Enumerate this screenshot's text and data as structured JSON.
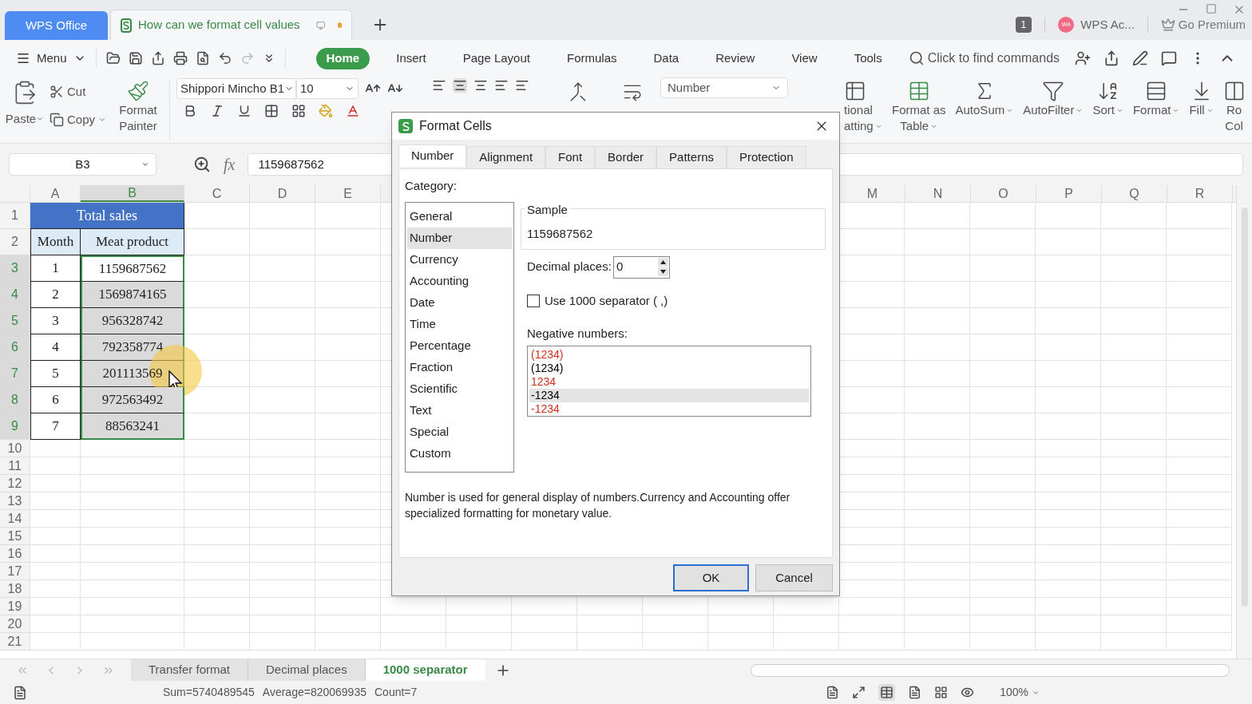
{
  "title_bar": {
    "tabs": [
      {
        "label": "WPS Office",
        "kind": "home",
        "selected": false
      },
      {
        "label": "How  can we format cell values",
        "kind": "document",
        "selected": true
      }
    ],
    "page_count": "1",
    "account_avatar": "WA",
    "account_name": "WPS Ac...",
    "premium": "Go Premium"
  },
  "menu_bar": {
    "menu": "Menu",
    "tabs": [
      {
        "label": "Home",
        "selected": true
      },
      {
        "label": "Insert",
        "selected": false
      },
      {
        "label": "Page Layout",
        "selected": false
      },
      {
        "label": "Formulas",
        "selected": false
      },
      {
        "label": "Data",
        "selected": false
      },
      {
        "label": "Review",
        "selected": false
      },
      {
        "label": "View",
        "selected": false
      },
      {
        "label": "Tools",
        "selected": false
      }
    ],
    "search": {
      "placeholder": "Click to find commands"
    }
  },
  "ribbon": {
    "paste": "Paste",
    "cut": "Cut",
    "copy": "Copy",
    "format_painter": [
      "Format",
      "Painter"
    ],
    "font": "Shippori Mincho B1",
    "font_size": "10",
    "number_format": "Number",
    "right_items": [
      {
        "kind": "cond",
        "lines": [
          "tional",
          "atting"
        ]
      },
      {
        "kind": "table",
        "lines": [
          "Format as",
          "Table"
        ]
      },
      {
        "kind": "sum",
        "lines": [
          "AutoSum"
        ]
      },
      {
        "kind": "filter",
        "lines": [
          "AutoFilter"
        ]
      },
      {
        "kind": "sort",
        "lines": [
          "Sort"
        ]
      },
      {
        "kind": "format",
        "lines": [
          "Format"
        ]
      },
      {
        "kind": "fill",
        "lines": [
          "Fill"
        ]
      },
      {
        "kind": "rows",
        "lines": [
          "Ro",
          "Col"
        ]
      }
    ]
  },
  "formula_bar": {
    "cell": "B3",
    "function_label": "fx",
    "value": "1159687562"
  },
  "sheet": {
    "columns_left": [
      {
        "label": "A",
        "selected": false
      },
      {
        "label": "B",
        "selected": true
      },
      {
        "label": "C",
        "selected": false
      },
      {
        "label": "D",
        "selected": false
      },
      {
        "label": "E",
        "selected": false
      }
    ],
    "columns_right": [
      {
        "label": "M",
        "selected": false
      },
      {
        "label": "N",
        "selected": false
      },
      {
        "label": "O",
        "selected": false
      },
      {
        "label": "P",
        "selected": false
      },
      {
        "label": "Q",
        "selected": false
      },
      {
        "label": "R",
        "selected": false
      }
    ],
    "rows": [
      {
        "number": "1",
        "selected": false,
        "kind": "title",
        "title": "Total sales"
      },
      {
        "number": "2",
        "selected": false,
        "kind": "header",
        "cells": [
          "Month",
          "Meat product"
        ]
      },
      {
        "number": "3",
        "selected": true,
        "kind": "data",
        "month": "1",
        "value": {
          "text": "1159687562",
          "selected": true,
          "active": true
        }
      },
      {
        "number": "4",
        "selected": true,
        "kind": "data",
        "month": "2",
        "value": {
          "text": "1569874165",
          "selected": true,
          "active": false
        }
      },
      {
        "number": "5",
        "selected": true,
        "kind": "data",
        "month": "3",
        "value": {
          "text": "956328742",
          "selected": true,
          "active": false
        }
      },
      {
        "number": "6",
        "selected": true,
        "kind": "data",
        "month": "4",
        "value": {
          "text": "792358774",
          "selected": true,
          "active": false
        }
      },
      {
        "number": "7",
        "selected": true,
        "kind": "data",
        "month": "5",
        "value": {
          "text": "201113569",
          "selected": true,
          "active": false,
          "pointer": true
        }
      },
      {
        "number": "8",
        "selected": true,
        "kind": "data",
        "month": "6",
        "value": {
          "text": "972563492",
          "selected": true,
          "active": false
        }
      },
      {
        "number": "9",
        "selected": true,
        "kind": "data",
        "month": "7",
        "value": {
          "text": "88563241",
          "selected": true,
          "active": false
        }
      },
      {
        "number": "10",
        "selected": false,
        "kind": "empty"
      },
      {
        "number": "11",
        "selected": false,
        "kind": "empty"
      },
      {
        "number": "12",
        "selected": false,
        "kind": "empty"
      },
      {
        "number": "13",
        "selected": false,
        "kind": "empty"
      },
      {
        "number": "14",
        "selected": false,
        "kind": "empty"
      },
      {
        "number": "15",
        "selected": false,
        "kind": "empty"
      },
      {
        "number": "16",
        "selected": false,
        "kind": "empty"
      },
      {
        "number": "17",
        "selected": false,
        "kind": "empty"
      },
      {
        "number": "18",
        "selected": false,
        "kind": "empty"
      },
      {
        "number": "19",
        "selected": false,
        "kind": "empty"
      },
      {
        "number": "20",
        "selected": false,
        "kind": "empty"
      },
      {
        "number": "21",
        "selected": false,
        "kind": "empty"
      }
    ]
  },
  "sheet_tabs": [
    {
      "label": "Transfer format",
      "selected": false
    },
    {
      "label": "Decimal places",
      "selected": false
    },
    {
      "label": "1000 separator",
      "selected": true
    }
  ],
  "status_bar": {
    "stats": [
      "Sum=5740489545",
      "Average=820069935",
      "Count=7"
    ],
    "zoom": "100%"
  },
  "dialog": {
    "title": "Format Cells",
    "tabs": [
      {
        "label": "Number",
        "selected": true
      },
      {
        "label": "Alignment",
        "selected": false
      },
      {
        "label": "Font",
        "selected": false
      },
      {
        "label": "Border",
        "selected": false
      },
      {
        "label": "Patterns",
        "selected": false
      },
      {
        "label": "Protection",
        "selected": false
      }
    ],
    "category_label": "Category:",
    "categories": [
      {
        "label": "General",
        "selected": false
      },
      {
        "label": "Number",
        "selected": true
      },
      {
        "label": "Currency",
        "selected": false
      },
      {
        "label": "Accounting",
        "selected": false
      },
      {
        "label": "Date",
        "selected": false
      },
      {
        "label": "Time",
        "selected": false
      },
      {
        "label": "Percentage",
        "selected": false
      },
      {
        "label": "Fraction",
        "selected": false
      },
      {
        "label": "Scientific",
        "selected": false
      },
      {
        "label": "Text",
        "selected": false
      },
      {
        "label": "Special",
        "selected": false
      },
      {
        "label": "Custom",
        "selected": false
      }
    ],
    "sample_label": "Sample",
    "sample": "1159687562",
    "decimal_label": "Decimal places:",
    "decimal_value": "0",
    "separator": {
      "label": "Use 1000 separator ( ,)",
      "checked": false
    },
    "negative_label": "Negative numbers:",
    "negative_options": [
      {
        "label": "(1234)",
        "color": "#d0301c",
        "selected": false
      },
      {
        "label": "(1234)",
        "color": "#000000",
        "selected": false
      },
      {
        "label": "1234",
        "color": "#d0301c",
        "selected": false
      },
      {
        "label": "-1234",
        "color": "#000000",
        "selected": true
      },
      {
        "label": "-1234",
        "color": "#d0301c",
        "selected": false
      }
    ],
    "description": "Number is used for general display of numbers.Currency and Accounting offer specialized formatting for monetary value.",
    "ok": "OK",
    "cancel": "Cancel"
  }
}
